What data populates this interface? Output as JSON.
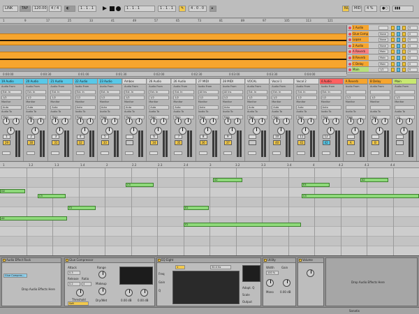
{
  "transport": {
    "tempo": "120.00",
    "meter": "4 / 4",
    "position": "1 . 1 . 1",
    "key": "NUM",
    "cpu": "4 %",
    "colors": {
      "bg": "#bdbdbd",
      "accent": "#f2c94c"
    }
  },
  "arrangement": {
    "ruler_top": [
      "1",
      "9",
      "17",
      "25",
      "33",
      "41",
      "49",
      "57",
      "65",
      "73",
      "81",
      "89",
      "97",
      "105",
      "113",
      "121"
    ],
    "ruler_bottom": [
      "0:00:00",
      "0:00:30",
      "0:01:00",
      "0:01:30",
      "0:02:00",
      "0:02:30",
      "0:03:00",
      "0:03:30",
      "0:04:00"
    ],
    "clip_color": "#f6a52e",
    "tracks": [
      {
        "name": "1 Audio",
        "chip": "",
        "color": "#f6a52e"
      },
      {
        "name": "Glue Comp",
        "chip": "None",
        "color": "#f6a52e"
      },
      {
        "name": "Lopan",
        "chip": "None",
        "color": "#f6a52e"
      },
      {
        "name": "2 Audio",
        "chip": "None",
        "color": "#f6a52e"
      },
      {
        "name": "A Reverb",
        "chip": "Main",
        "color": "#ff8080"
      },
      {
        "name": "B Reverb",
        "chip": "Main",
        "color": "#f6a52e"
      },
      {
        "name": "C Delay",
        "chip": "Main",
        "color": "#f6a52e"
      },
      {
        "name": "Main",
        "chip": "1/2",
        "color": "#b7e07a"
      }
    ]
  },
  "mixer": {
    "strips": [
      {
        "title": "19 Audio",
        "input": "Ext. In",
        "monitor": "Auto",
        "output": "Main",
        "volume": "29",
        "track": "1",
        "color": "#58c8e8"
      },
      {
        "title": "20 Audio",
        "input": "Ext. In",
        "monitor": "Auto",
        "output": "Main",
        "volume": "30",
        "track": "2",
        "color": "#58c8e8"
      },
      {
        "title": "21 Audio",
        "input": "Ext. In",
        "monitor": "Auto",
        "output": "Main",
        "volume": "31",
        "track": "3",
        "color": "#58c8e8"
      },
      {
        "title": "22 Audio",
        "input": "Ext. In",
        "monitor": "Auto",
        "output": "Main",
        "volume": "32",
        "track": "4",
        "color": "#58c8e8"
      },
      {
        "title": "23 Audio",
        "input": "Ext. In",
        "monitor": "Auto",
        "output": "Main",
        "volume": "33",
        "track": "5",
        "color": "#58c8e8"
      },
      {
        "title": "Ambox",
        "input": "Ext. In",
        "monitor": "Auto",
        "output": "Main",
        "volume": "",
        "track": "",
        "color": "#d9d9d9"
      },
      {
        "title": "26 Audio",
        "input": "Ext. In",
        "monitor": "Auto",
        "output": "Main",
        "volume": "34",
        "track": "6",
        "color": "#d9d9d9"
      },
      {
        "title": "26 Audio",
        "input": "Ext. In",
        "monitor": "Auto",
        "output": "Main",
        "volume": "35",
        "track": "7",
        "color": "#d9d9d9"
      },
      {
        "title": "27 MIDI",
        "input": "All Ins",
        "monitor": "Auto",
        "output": "Main",
        "volume": "36",
        "track": "8",
        "color": "#d9d9d9"
      },
      {
        "title": "28 MIDI",
        "input": "All Ins",
        "monitor": "Auto",
        "output": "Main",
        "volume": "37",
        "track": "9",
        "color": "#d9d9d9"
      },
      {
        "title": "VOCAL",
        "input": "Ext. In",
        "monitor": "Auto",
        "output": "Main",
        "volume": "",
        "track": "",
        "color": "#d9d9d9"
      },
      {
        "title": "Vocal 1",
        "input": "Ext. In",
        "monitor": "Auto",
        "output": "Main",
        "volume": "40",
        "track": "10",
        "color": "#d9d9d9"
      },
      {
        "title": "Vocal 2",
        "input": "Ext. In",
        "monitor": "Auto",
        "output": "Main",
        "volume": "41",
        "track": "11",
        "color": "#d9d9d9"
      },
      {
        "title": "4 Audio",
        "input": "Ext. In",
        "monitor": "Auto",
        "output": "Main",
        "volume": "42",
        "track": "12",
        "color": "#ff6060"
      },
      {
        "title": "A Reverb",
        "input": "",
        "monitor": "",
        "output": "Main",
        "volume": "A",
        "track": "",
        "color": "#f6a52e"
      },
      {
        "title": "B Delay",
        "input": "",
        "monitor": "",
        "output": "Main",
        "volume": "B",
        "track": "",
        "color": "#f6a52e"
      },
      {
        "title": "Main",
        "input": "",
        "monitor": "",
        "output": "1/2",
        "volume": "",
        "track": "",
        "color": "#c8e870"
      }
    ]
  },
  "clip_editor": {
    "ruler": [
      "1",
      "1.2",
      "1.3",
      "1.4",
      "2",
      "2.2",
      "2.3",
      "2.4",
      "3",
      "3.2",
      "3.3",
      "3.4",
      "4",
      "4.2",
      "4.3",
      "4.4"
    ],
    "notes": [
      {
        "label": "C3"
      },
      {
        "label": "A2"
      },
      {
        "label": "E3"
      },
      {
        "label": "A2"
      },
      {
        "label": "C3"
      },
      {
        "label": "F2"
      },
      {
        "label": "E2"
      },
      {
        "label": "C3"
      },
      {
        "label": "A2"
      },
      {
        "label": "F2"
      },
      {
        "label": "D2"
      }
    ],
    "note_color": "#8ed97a"
  },
  "devices": {
    "rack": {
      "title": "Audio Effect Rack",
      "chain": "Glue Compres...",
      "drop": "Drop Audio Effects Here"
    },
    "glue": {
      "title": "Glue Compressor",
      "attack": "Attack",
      "release": "Release",
      "ratio": "Ratio",
      "threshold": "Threshold",
      "makeup": "Makeup",
      "range": "Range",
      "dry_wet": "Dry/Wet",
      "soft": "Soft",
      "clip": "Clip",
      "peak": "Peak",
      "val_threshold": "0.00 dB",
      "val_makeup": "0.00 dB",
      "val_attack": "0.3",
      "val_release": "0.2",
      "val_ratio": "4",
      "val_range": "-",
      "val_drywet": "100 %"
    },
    "eq": {
      "title": "EQ Eight",
      "freq": "Freq",
      "gain": "Gain",
      "q": "Q",
      "mode": "Stereo",
      "val_freq": "30.0 Hz",
      "val_gain": "0.00 dB",
      "val_q": "0.71",
      "adapt": "Adapt. Q",
      "scale": "Scale",
      "output": "Output"
    },
    "utility": {
      "title": "Utility",
      "width": "Width",
      "mono": "Mono",
      "bass": "Bass Mono",
      "gain": "Gain",
      "val_width": "100 %",
      "val_gain": "0.00 dB"
    },
    "vol": {
      "title": "Volume",
      "drop": "Drop Audio Effects Here"
    }
  },
  "status": {
    "left": "",
    "right": "Sonatix"
  }
}
